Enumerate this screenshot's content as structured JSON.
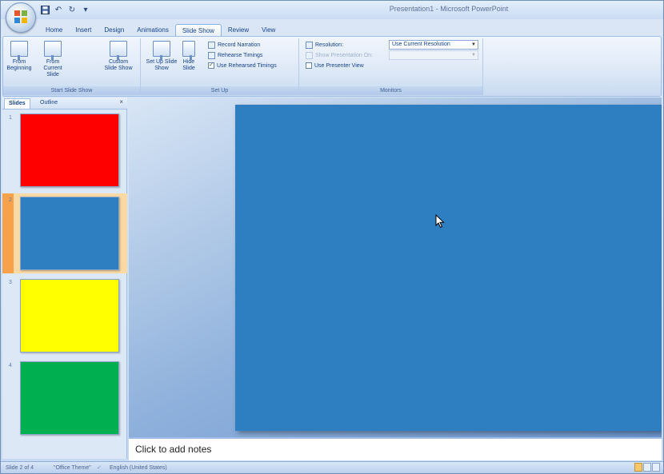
{
  "app": {
    "window_title": "Presentation1 - Microsoft PowerPoint"
  },
  "quick_access": [
    "save-icon",
    "undo-icon",
    "redo-icon",
    "customize-icon"
  ],
  "tabs": [
    {
      "label": "Home"
    },
    {
      "label": "Insert"
    },
    {
      "label": "Design"
    },
    {
      "label": "Animations"
    },
    {
      "label": "Slide Show",
      "active": true
    },
    {
      "label": "Review"
    },
    {
      "label": "View"
    }
  ],
  "ribbon": {
    "start_group": {
      "label": "Start Slide Show",
      "from_beginning": "From Beginning",
      "from_current": "From Current Slide",
      "custom": "Custom Slide Show"
    },
    "setup_group": {
      "label": "Set Up",
      "setup_show": "Set Up Slide Show",
      "hide_slide": "Hide Slide",
      "record_narration": "Record Narration",
      "rehearse_timings": "Rehearse Timings",
      "use_rehearsed": "Use Rehearsed Timings",
      "use_rehearsed_checked": true
    },
    "monitors_group": {
      "label": "Monitors",
      "resolution_label": "Resolution:",
      "resolution_value": "Use Current Resolution",
      "show_on_label": "Show Presentation On:",
      "show_on_value": "",
      "presenter_view": "Use Presenter View",
      "presenter_view_checked": false
    }
  },
  "left_pane": {
    "tabs": [
      {
        "label": "Slides",
        "active": true
      },
      {
        "label": "Outline"
      }
    ],
    "close_glyph": "×",
    "slides": [
      {
        "number": "1",
        "color": "#ff0000"
      },
      {
        "number": "2",
        "color": "#2e7fc1",
        "selected": true
      },
      {
        "number": "3",
        "color": "#ffff00"
      },
      {
        "number": "4",
        "color": "#00b050"
      }
    ]
  },
  "main": {
    "slide_color": "#2e7fc1",
    "notes_placeholder": "Click to add notes"
  },
  "status": {
    "slide_info": "Slide 2 of 4",
    "theme": "\"Office Theme\"",
    "language": "English (United States)"
  },
  "colors": {
    "accent_orange": "#f7a14a",
    "selection_bg": "#fbd9a3",
    "ribbon_text": "#15428b"
  }
}
